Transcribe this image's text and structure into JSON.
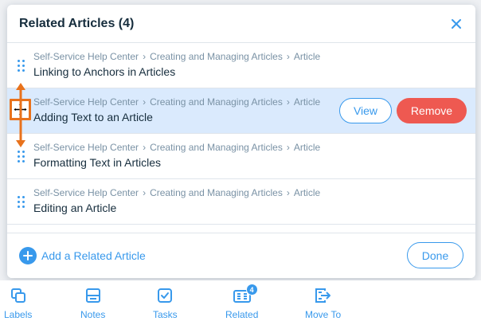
{
  "panel": {
    "title": "Related Articles (4)",
    "close_icon": "close-icon"
  },
  "articles": [
    {
      "crumbs": [
        "Self-Service Help Center",
        "Creating and Managing Articles",
        "Article"
      ],
      "title": "Linking to Anchors in Articles"
    },
    {
      "crumbs": [
        "Self-Service Help Center",
        "Creating and Managing Articles",
        "Article"
      ],
      "title": "Adding Text to an Article",
      "highlighted": true,
      "view_label": "View",
      "remove_label": "Remove"
    },
    {
      "crumbs": [
        "Self-Service Help Center",
        "Creating and Managing Articles",
        "Article"
      ],
      "title": "Formatting Text in Articles"
    },
    {
      "crumbs": [
        "Self-Service Help Center",
        "Creating and Managing Articles",
        "Article"
      ],
      "title": "Editing an Article"
    }
  ],
  "breadcrumb_separator": "›",
  "footer": {
    "add_label": "Add a Related Article",
    "done_label": "Done"
  },
  "toolbar": {
    "items": [
      {
        "label": "Labels",
        "icon": "labels-icon"
      },
      {
        "label": "Notes",
        "icon": "notes-icon"
      },
      {
        "label": "Tasks",
        "icon": "tasks-icon"
      },
      {
        "label": "Related",
        "icon": "related-icon",
        "badge": "4"
      },
      {
        "label": "Move To",
        "icon": "move-to-icon"
      }
    ]
  },
  "colors": {
    "accent": "#3899ec",
    "remove": "#ee5951",
    "highlight_row": "#daeafd",
    "drag_annotation": "#e8721c"
  }
}
